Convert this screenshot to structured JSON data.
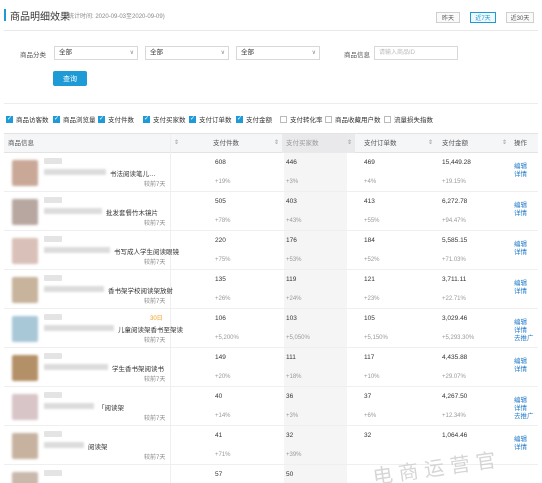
{
  "header": {
    "title": "商品明细效果",
    "range": "(统计时间: 2020-09-03至2020-09-09)"
  },
  "quick_ranges": [
    {
      "label": "昨天",
      "active": false
    },
    {
      "label": "近7天",
      "active": true
    },
    {
      "label": "近30天",
      "active": false
    }
  ],
  "filters": {
    "category_label": "商品分类",
    "selects": [
      "全部",
      "全部",
      "全部"
    ],
    "info_label": "商品信息",
    "info_placeholder": "请输入商品ID",
    "query_label": "查询"
  },
  "metrics": [
    {
      "label": "商品访客数",
      "checked": true
    },
    {
      "label": "商品浏览量",
      "checked": true
    },
    {
      "label": "支付件数",
      "checked": true
    },
    {
      "label": "支付买家数",
      "checked": true
    },
    {
      "label": "支付订单数",
      "checked": true
    },
    {
      "label": "支付金额",
      "checked": true
    },
    {
      "label": "支付转化率",
      "checked": false
    },
    {
      "label": "商品收藏用户数",
      "checked": false
    },
    {
      "label": "流量损失指数",
      "checked": false
    }
  ],
  "table": {
    "columns": [
      "商品信息",
      "支付件数",
      "支付买家数",
      "支付订单数",
      "支付金额",
      "操作"
    ],
    "rows": [
      {
        "name": "书法阅读笔儿…",
        "time": "较前7天",
        "tag": "",
        "qty": "608",
        "qty_c": "+19%",
        "buyers": "446",
        "buyers_c": "+3%",
        "orders": "469",
        "orders_c": "+4%",
        "amount": "15,449.28",
        "amount_c": "+19.15%",
        "ops": [
          "编辑",
          "详情"
        ]
      },
      {
        "name": "批发套餐竹木镜片",
        "time": "较前7天",
        "tag": "",
        "qty": "505",
        "qty_c": "+78%",
        "buyers": "403",
        "buyers_c": "+43%",
        "orders": "413",
        "orders_c": "+55%",
        "amount": "6,272.78",
        "amount_c": "+94.47%",
        "ops": [
          "编辑",
          "详情"
        ]
      },
      {
        "name": "书写成人学生阅读眼镜",
        "time": "较前7天",
        "tag": "",
        "qty": "220",
        "qty_c": "+75%",
        "buyers": "176",
        "buyers_c": "+53%",
        "orders": "184",
        "orders_c": "+52%",
        "amount": "5,585.15",
        "amount_c": "+71.03%",
        "ops": [
          "编辑",
          "详情"
        ]
      },
      {
        "name": "香书架学校阅读架放射",
        "time": "较前7天",
        "tag": "",
        "qty": "135",
        "qty_c": "+26%",
        "buyers": "119",
        "buyers_c": "+24%",
        "orders": "121",
        "orders_c": "+23%",
        "amount": "3,711.11",
        "amount_c": "+22.71%",
        "ops": [
          "编辑",
          "详情"
        ]
      },
      {
        "name": "儿童阅读架香书至架读",
        "time": "较前7天",
        "tag": "30日",
        "qty": "106",
        "qty_c": "+5,200%",
        "buyers": "103",
        "buyers_c": "+5,050%",
        "orders": "105",
        "orders_c": "+5,150%",
        "amount": "3,029.46",
        "amount_c": "+5,293.30%",
        "ops": [
          "编辑",
          "详情",
          "去推广"
        ]
      },
      {
        "name": "学生香书架阅读书",
        "time": "较前7天",
        "tag": "",
        "qty": "149",
        "qty_c": "+20%",
        "buyers": "111",
        "buyers_c": "+18%",
        "orders": "117",
        "orders_c": "+10%",
        "amount": "4,435.88",
        "amount_c": "+29.07%",
        "ops": [
          "编辑",
          "详情"
        ]
      },
      {
        "name": "「阅读架",
        "time": "较前7天",
        "tag": "",
        "qty": "40",
        "qty_c": "+14%",
        "buyers": "36",
        "buyers_c": "+3%",
        "orders": "37",
        "orders_c": "+6%",
        "amount": "4,267.50",
        "amount_c": "+12.34%",
        "ops": [
          "编辑",
          "详情",
          "去推广"
        ]
      },
      {
        "name": "阅读架",
        "time": "较前7天",
        "tag": "",
        "qty": "41",
        "qty_c": "+71%",
        "buyers": "32",
        "buyers_c": "+39%",
        "orders": "32",
        "orders_c": "",
        "amount": "1,064.46",
        "amount_c": "",
        "ops": [
          "编辑",
          "详情"
        ]
      },
      {
        "name": "",
        "time": "",
        "tag": "",
        "qty": "57",
        "qty_c": "",
        "buyers": "50",
        "buyers_c": "",
        "orders": "",
        "orders_c": "",
        "amount": "",
        "amount_c": "",
        "ops": []
      }
    ]
  },
  "watermark": "电商运营官",
  "colors": {
    "accent": "#1e9bd7",
    "link": "#1e78c8"
  }
}
